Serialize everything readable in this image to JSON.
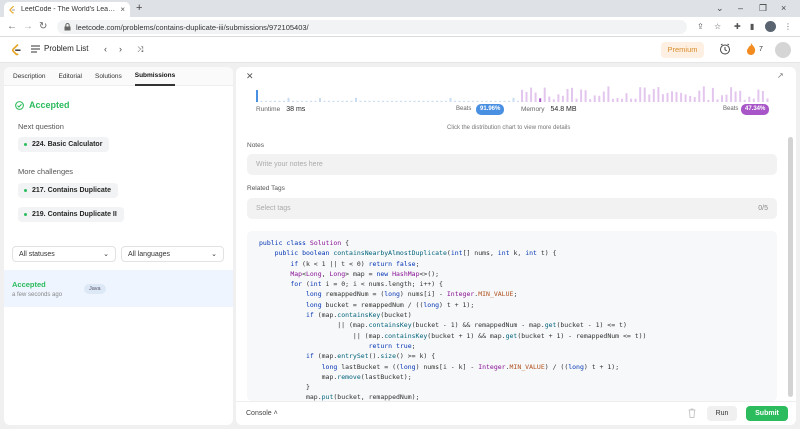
{
  "browser": {
    "tab_title": "LeetCode - The World's Leading ...",
    "tab_close": "×",
    "new_tab": "+",
    "url": "leetcode.com/problems/contains-duplicate-iii/submissions/972105403/",
    "win_controls": [
      "⌄",
      "–",
      "❐",
      "×"
    ]
  },
  "header": {
    "problem_list": "Problem List",
    "premium": "Premium",
    "streak": "7"
  },
  "left": {
    "tabs": [
      "Description",
      "Editorial",
      "Solutions",
      "Submissions"
    ],
    "status": "Accepted",
    "next_question_label": "Next question",
    "next_question": "224. Basic Calculator",
    "more_label": "More challenges",
    "challenges": [
      "217. Contains Duplicate",
      "219. Contains Duplicate II"
    ],
    "filter_status": "All statuses",
    "filter_lang": "All languages",
    "submission": {
      "status": "Accepted",
      "time": "a few seconds ago",
      "lang": "Java"
    }
  },
  "right": {
    "runtime_label": "Runtime",
    "runtime_value": "38 ms",
    "runtime_beats_label": "Beats",
    "runtime_beats": "91.96%",
    "runtime_percentile": 0.9196,
    "memory_label": "Memory",
    "memory_value": "54.8 MB",
    "memory_beats_label": "Beats",
    "memory_beats": "47.34%",
    "memory_percentile": 0.4734,
    "hint": "Click the distribution chart to view more details",
    "notes_label": "Notes",
    "notes_placeholder": "Write your notes here",
    "tags_label": "Related Tags",
    "tags_placeholder": "Select tags",
    "tags_count": "0/5",
    "console": "Console",
    "run": "Run",
    "submit": "Submit",
    "accent_green": "#2cbb5d",
    "runtime_color": "#4a90e2",
    "memory_color": "#a855c7"
  },
  "code_lines": [
    "public class Solution {",
    "    public boolean containsNearbyAlmostDuplicate(int[] nums, int k, int t) {",
    "        if (k < 1 || t < 0) return false;",
    "        Map<Long, Long> map = new HashMap<>();",
    "        for (int i = 0; i < nums.length; i++) {",
    "            long remappedNum = (long) nums[i] - Integer.MIN_VALUE;",
    "            long bucket = remappedNum / ((long) t + 1);",
    "            if (map.containsKey(bucket)",
    "                    || (map.containsKey(bucket - 1) && remappedNum - map.get(bucket - 1) <= t)",
    "                        || (map.containsKey(bucket + 1) && map.get(bucket + 1) - remappedNum <= t))",
    "                            return true;",
    "            if (map.entrySet().size() >= k) {",
    "                long lastBucket = ((long) nums[i - k] - Integer.MIN_VALUE) / ((long) t + 1);",
    "                map.remove(lastBucket);",
    "            }",
    "            map.put(bucket, remappedNum);"
  ]
}
